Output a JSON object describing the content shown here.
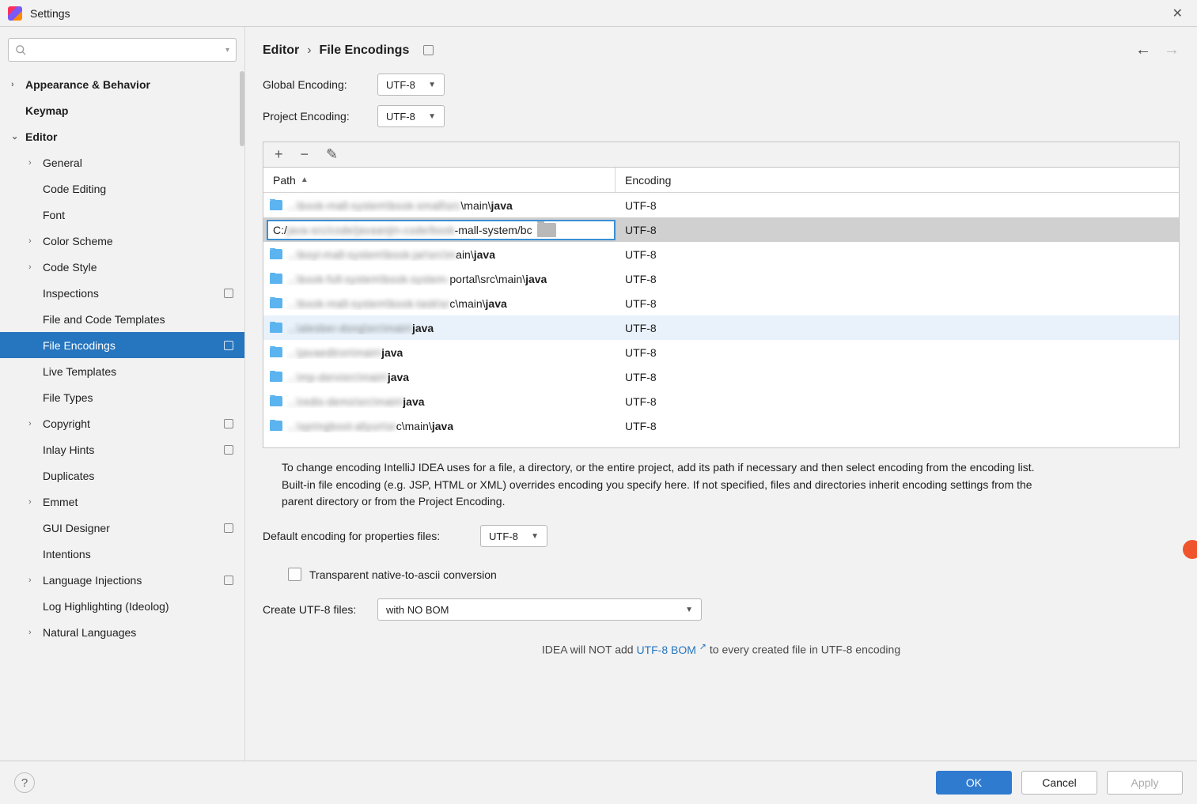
{
  "window": {
    "title": "Settings"
  },
  "sidebar": {
    "search_placeholder": "",
    "items": [
      {
        "label": "Appearance & Behavior",
        "chev": "›",
        "bold": true,
        "level": 0
      },
      {
        "label": "Keymap",
        "chev": "",
        "bold": true,
        "level": 0
      },
      {
        "label": "Editor",
        "chev": "⌄",
        "bold": true,
        "level": 0
      },
      {
        "label": "General",
        "chev": "›",
        "level": 1
      },
      {
        "label": "Code Editing",
        "chev": "",
        "level": 1
      },
      {
        "label": "Font",
        "chev": "",
        "level": 1
      },
      {
        "label": "Color Scheme",
        "chev": "›",
        "level": 1
      },
      {
        "label": "Code Style",
        "chev": "›",
        "level": 1
      },
      {
        "label": "Inspections",
        "chev": "",
        "level": 1,
        "badge": true
      },
      {
        "label": "File and Code Templates",
        "chev": "",
        "level": 1
      },
      {
        "label": "File Encodings",
        "chev": "",
        "level": 1,
        "badge": true,
        "selected": true
      },
      {
        "label": "Live Templates",
        "chev": "",
        "level": 1
      },
      {
        "label": "File Types",
        "chev": "",
        "level": 1
      },
      {
        "label": "Copyright",
        "chev": "›",
        "level": 1,
        "badge": true
      },
      {
        "label": "Inlay Hints",
        "chev": "",
        "level": 1,
        "badge": true
      },
      {
        "label": "Duplicates",
        "chev": "",
        "level": 1
      },
      {
        "label": "Emmet",
        "chev": "›",
        "level": 1
      },
      {
        "label": "GUI Designer",
        "chev": "",
        "level": 1,
        "badge": true
      },
      {
        "label": "Intentions",
        "chev": "",
        "level": 1
      },
      {
        "label": "Language Injections",
        "chev": "›",
        "level": 1,
        "badge": true
      },
      {
        "label": "Log Highlighting (Ideolog)",
        "chev": "",
        "level": 1
      },
      {
        "label": "Natural Languages",
        "chev": "›",
        "level": 1
      }
    ]
  },
  "breadcrumb": {
    "parent": "Editor",
    "current": "File Encodings"
  },
  "global_encoding": {
    "label": "Global Encoding:",
    "value": "UTF-8"
  },
  "project_encoding": {
    "label": "Project Encoding:",
    "value": "UTF-8"
  },
  "columns": {
    "path": "Path",
    "encoding": "Encoding"
  },
  "rows": [
    {
      "blur": "...\\book-mall-system\\book-small\\src",
      "plain": "\\main\\",
      "bold": "java",
      "enc": "UTF-8"
    },
    {
      "selected": true,
      "input": "C:/java-src/code/javaanjin-code/book-mall-system/bc",
      "enc": "UTF-8"
    },
    {
      "blur": "...\\boyi-mall-system\\book-jar\\src\\m",
      "plain": "ain\\",
      "bold": "java",
      "enc": "UTF-8"
    },
    {
      "blur": "...\\book-full-system\\book-system-",
      "plain": "portal\\src\\main\\",
      "bold": "java",
      "enc": "UTF-8"
    },
    {
      "blur": "...\\book-mall-system\\book-task\\sr",
      "plain": "c\\main\\",
      "bold": "java",
      "enc": "UTF-8"
    },
    {
      "hover": true,
      "blur": "...\\alesber-dong\\src\\main\\",
      "plain": "",
      "bold": "java",
      "enc": "UTF-8"
    },
    {
      "blur": "...\\javaedtron\\main\\",
      "plain": "",
      "bold": "java",
      "enc": "UTF-8"
    },
    {
      "blur": "...\\mp-dervisrc\\main\\",
      "plain": "",
      "bold": "java",
      "enc": "UTF-8"
    },
    {
      "blur": "...\\redis-demo\\src\\main\\",
      "plain": "",
      "bold": "java",
      "enc": "UTF-8"
    },
    {
      "blur": "...\\springboot-aliyun\\sr",
      "plain": "c\\main\\",
      "bold": "java",
      "enc": "UTF-8"
    }
  ],
  "help_text": "To change encoding IntelliJ IDEA uses for a file, a directory, or the entire project, add its path if necessary and then select encoding from the encoding list. Built-in file encoding (e.g. JSP, HTML or XML) overrides encoding you specify here. If not specified, files and directories inherit encoding settings from the parent directory or from the Project Encoding.",
  "properties_encoding": {
    "label": "Default encoding for properties files:",
    "value": "UTF-8"
  },
  "transparent_checkbox": "Transparent native-to-ascii conversion",
  "create_utf8": {
    "label": "Create UTF-8 files:",
    "value": "with NO BOM"
  },
  "bom_note": {
    "prefix": "IDEA will NOT add ",
    "link": "UTF-8 BOM",
    "suffix": "  to every created file in UTF-8 encoding"
  },
  "buttons": {
    "ok": "OK",
    "cancel": "Cancel",
    "apply": "Apply"
  }
}
